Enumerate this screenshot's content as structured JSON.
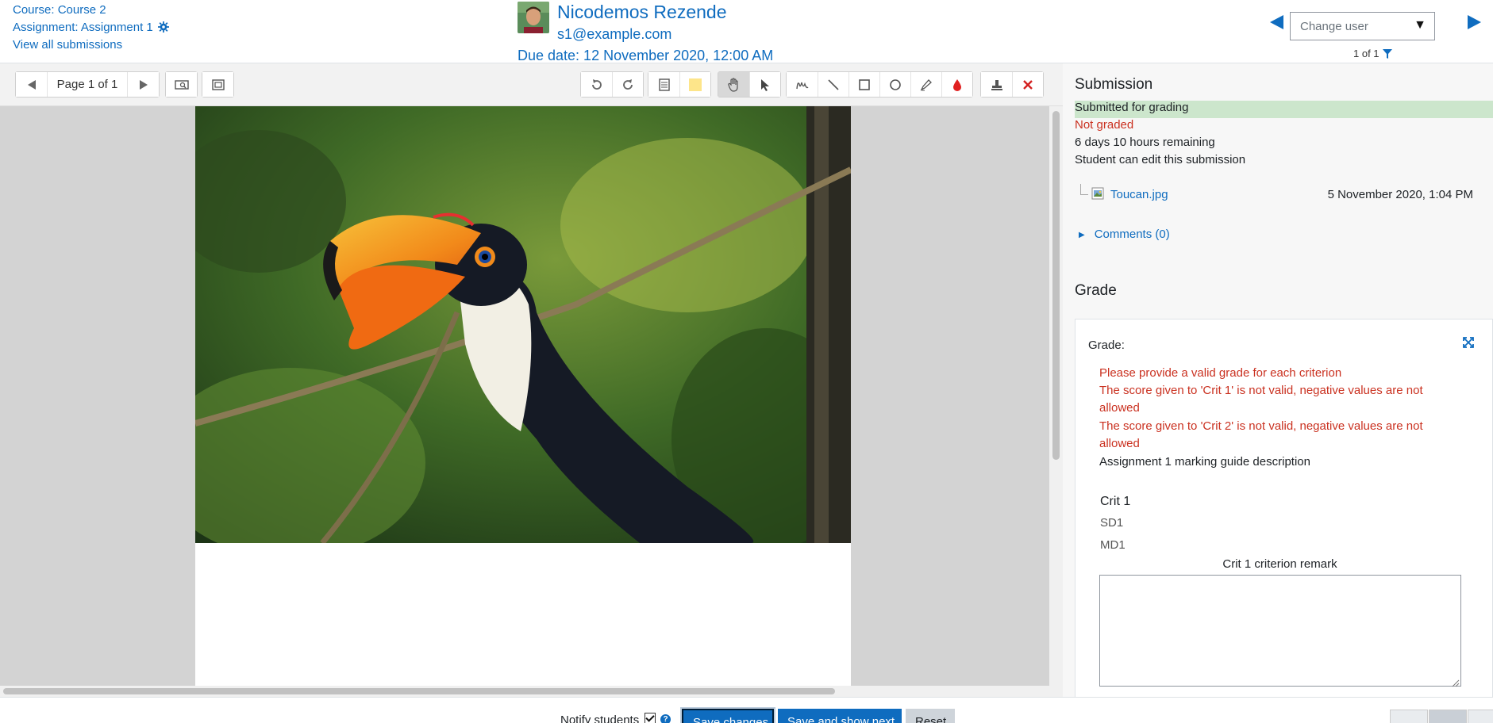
{
  "header": {
    "course_link": "Course: Course 2",
    "assignment_link": "Assignment: Assignment 1",
    "view_all_link": "View all submissions",
    "student_name": "Nicodemos Rezende",
    "student_email": "s1@example.com",
    "due_date": "Due date: 12 November 2020, 12:00 AM",
    "change_user_placeholder": "Change user",
    "user_count": "1 of 1"
  },
  "toolbar": {
    "page_label": "Page 1 of 1"
  },
  "submission": {
    "heading": "Submission",
    "status": "Submitted for grading",
    "grade_status": "Not graded",
    "time_remaining": "6 days 10 hours remaining",
    "edit_status": "Student can edit this submission",
    "file_name": "Toucan.jpg",
    "file_date": "5 November 2020, 1:04 PM",
    "comments_link": "Comments (0)"
  },
  "grade": {
    "heading": "Grade",
    "label": "Grade:",
    "errors": [
      "Please provide a valid grade for each criterion",
      "The score given to 'Crit 1' is not valid, negative values are not allowed",
      "The score given to 'Crit 2' is not valid, negative values are not allowed"
    ],
    "guide_description": "Assignment 1 marking guide description",
    "criterion": {
      "name": "Crit 1",
      "student_description": "SD1",
      "marker_description": "MD1",
      "remark_label": "Crit 1 criterion remark",
      "remark_value": ""
    }
  },
  "footer": {
    "notify_label": "Notify students",
    "notify_checked": true,
    "save_label": "Save changes",
    "save_next_label": "Save and show next",
    "reset_label": "Reset"
  },
  "colors": {
    "link": "#0f6cbf",
    "error": "#ca3120",
    "submitted_bg": "#cce6cc",
    "primary_button": "#0f6cbf"
  }
}
